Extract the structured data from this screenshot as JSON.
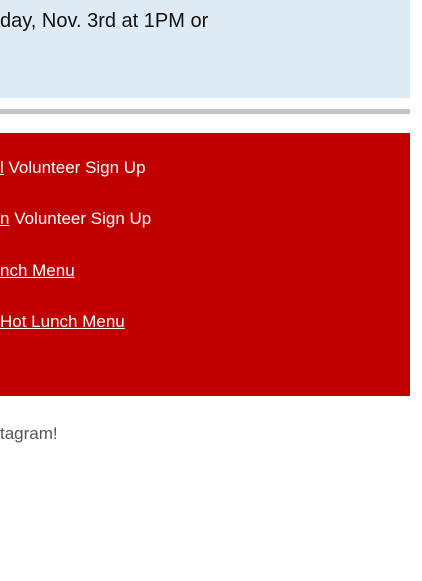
{
  "notice": {
    "text": "day, Nov. 3rd at 1PM or"
  },
  "links": [
    {
      "link_fragment": "l",
      "suffix": " Volunteer Sign Up"
    },
    {
      "link_fragment": "n",
      "suffix": " Volunteer Sign Up"
    },
    {
      "link_fragment": "nch Menu",
      "suffix": ""
    },
    {
      "link_fragment": "Hot Lunch Menu",
      "suffix": ""
    }
  ],
  "footer": {
    "text": "tagram!"
  },
  "colors": {
    "notice_background": "#deebf5",
    "panel_background": "#c00000",
    "divider": "#c3c3c3",
    "footer_text": "#555555"
  }
}
